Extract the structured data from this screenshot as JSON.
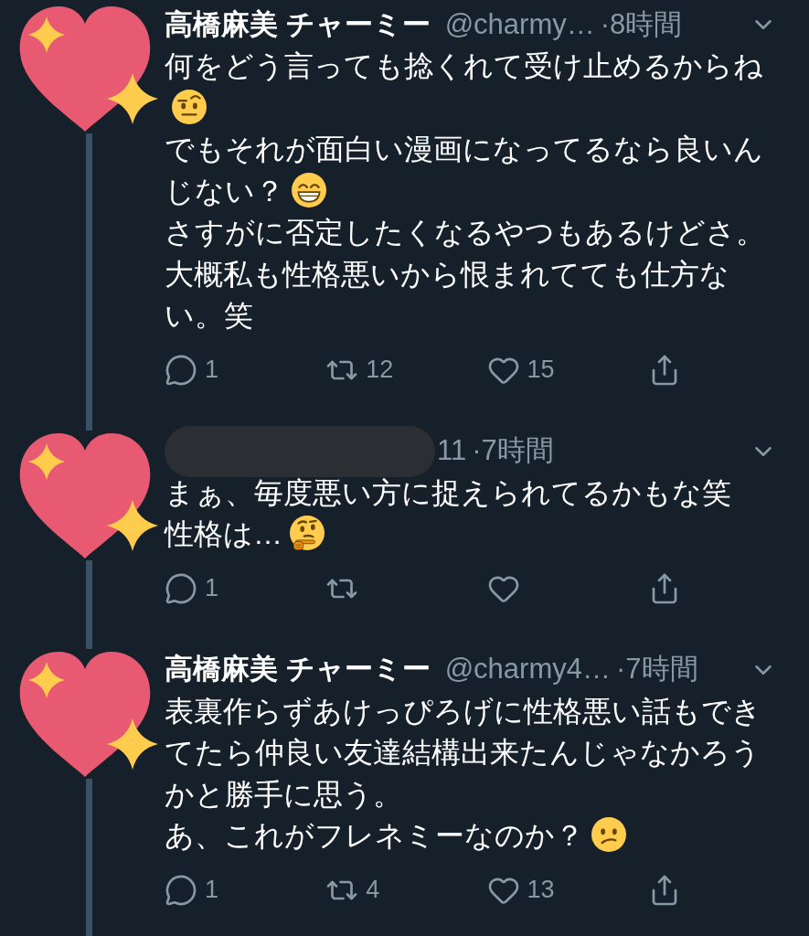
{
  "tweets": [
    {
      "name": "高橋麻美 チャーミー",
      "handle": "@charmy…",
      "time": "·8時間",
      "redacted": false,
      "thread_above": false,
      "thread_below": true,
      "paragraphs": [
        {
          "segments": [
            {
              "kind": "text",
              "text": "何をどう言っても捻くれて受け止めるからね"
            },
            {
              "kind": "skeptical"
            }
          ]
        },
        {
          "segments": [
            {
              "kind": "text",
              "text": "でもそれが面白い漫画になってるなら良いん"
            },
            {
              "kind": "text",
              "text": "じない？"
            },
            {
              "kind": "grin"
            }
          ]
        },
        {
          "segments": [
            {
              "kind": "text",
              "text": "さすがに否定したくなるやつもあるけどさ。"
            }
          ]
        },
        {
          "segments": [
            {
              "kind": "text",
              "text": "大概私も性格悪いから恨まれてても仕方ない。笑"
            }
          ]
        }
      ],
      "actions": [
        {
          "kind": "reply",
          "count": "1"
        },
        {
          "kind": "retweet",
          "count": "12"
        },
        {
          "kind": "like",
          "count": "15"
        },
        {
          "kind": "share"
        }
      ]
    },
    {
      "handle": "11",
      "time": "·7時間",
      "redacted": true,
      "thread_above": true,
      "thread_below": true,
      "paragraphs": [
        {
          "segments": [
            {
              "kind": "text",
              "text": "まぁ、毎度悪い方に捉えられてるかもな笑"
            }
          ]
        },
        {
          "segments": [
            {
              "kind": "text",
              "text": "性格は…"
            },
            {
              "kind": "thinking"
            }
          ]
        }
      ],
      "actions": [
        {
          "kind": "reply",
          "count": "1"
        },
        {
          "kind": "retweet"
        },
        {
          "kind": "like"
        },
        {
          "kind": "share"
        }
      ]
    },
    {
      "name": "高橋麻美 チャーミー",
      "handle": "@charmy4…",
      "time": "·7時間",
      "redacted": false,
      "thread_above": true,
      "thread_below": true,
      "paragraphs": [
        {
          "segments": [
            {
              "kind": "text",
              "text": "表裏作らずあけっぴろげに性格悪い話もできてたら仲良い友達結構出来たんじゃなかろうかと勝手に思う。"
            }
          ]
        },
        {
          "segments": [
            {
              "kind": "text",
              "text": "あ、これがフレネミーなのか？"
            },
            {
              "kind": "confused"
            }
          ]
        }
      ],
      "actions": [
        {
          "kind": "reply",
          "count": "1"
        },
        {
          "kind": "retweet",
          "count": "4"
        },
        {
          "kind": "like",
          "count": "13"
        },
        {
          "kind": "share"
        }
      ]
    }
  ]
}
